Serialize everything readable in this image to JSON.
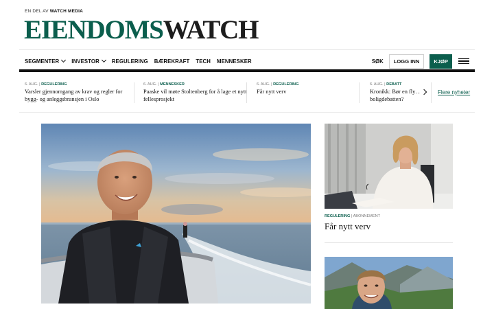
{
  "header": {
    "tagline_prefix": "EN DEL AV",
    "tagline_brand": "WATCH MEDIA",
    "logo_part1": "EIENDOMS",
    "logo_part2": "WATCH"
  },
  "nav": {
    "items": [
      {
        "label": "SEGMENTER",
        "dropdown": true
      },
      {
        "label": "INVESTOR",
        "dropdown": true
      },
      {
        "label": "REGULERING",
        "dropdown": false
      },
      {
        "label": "BÆREKRAFT",
        "dropdown": false
      },
      {
        "label": "TECH",
        "dropdown": false
      },
      {
        "label": "MENNESKER",
        "dropdown": false
      }
    ],
    "search_label": "SØK",
    "login_label": "LOGG INN",
    "buy_label": "KJØP"
  },
  "ticker": {
    "items": [
      {
        "date": "6. AUG.",
        "section": "REGULERING",
        "headline": "Varsler gjennomgang av krav og regler for bygg- og anleggsbransjen i Oslo"
      },
      {
        "date": "6. AUG.",
        "section": "MENNESKER",
        "headline": "Paaske vil møte Stoltenberg for å lage et nytt fellesprosjekt"
      },
      {
        "date": "6. AUG.",
        "section": "REGULERING",
        "headline": "Får nytt verv"
      },
      {
        "date": "6. AUG.",
        "section": "DEBATT",
        "headline": "Kronikk: Bør en fly… boligdebatten?"
      }
    ],
    "more_label": "Flere nyheter"
  },
  "side_article": {
    "section": "REGULERING",
    "access": "ABONNEMENT",
    "title": "Får nytt verv"
  },
  "colors": {
    "brand": "#0b5e4d",
    "text": "#111111"
  }
}
